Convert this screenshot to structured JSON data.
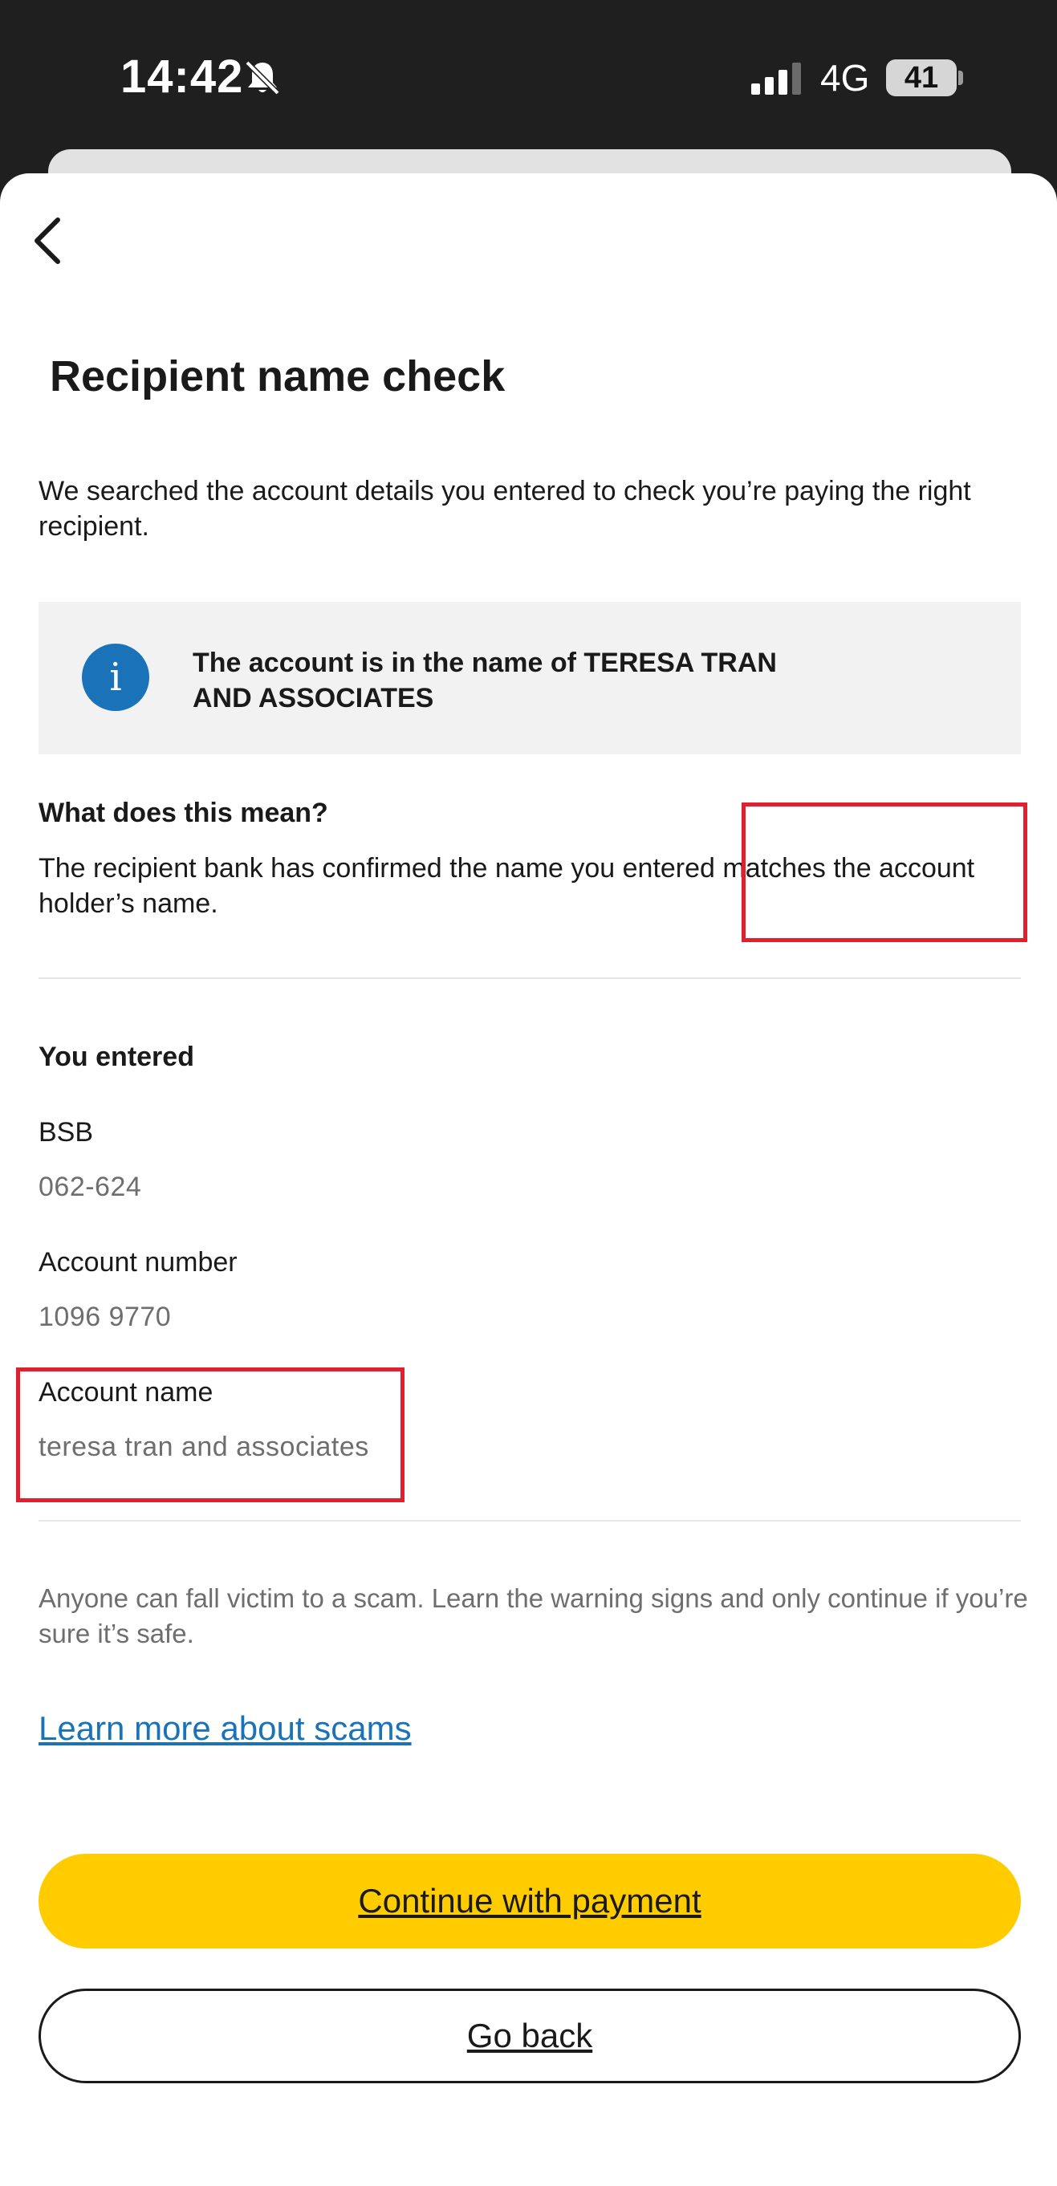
{
  "status_bar": {
    "time": "14:42",
    "network": "4G",
    "battery": "41"
  },
  "page": {
    "title": "Recipient name check",
    "intro": "We searched the account details you entered to check you’re paying the right recipient."
  },
  "info_box": {
    "icon": "info-icon",
    "line1": "The account is in the name of TERESA TRAN",
    "line2": "AND ASSOCIATES"
  },
  "explanation": {
    "heading": "What does this mean?",
    "body": "The recipient bank has confirmed the name you entered matches the account holder’s name."
  },
  "entered": {
    "heading": "You entered",
    "bsb_label": "BSB",
    "bsb_value": "062-624",
    "account_number_label": "Account number",
    "account_number_value": "1096 9770",
    "account_name_label": "Account name",
    "account_name_value": "teresa tran and associates"
  },
  "warning": {
    "text": "Anyone can fall victim to a scam. Learn the warning signs and only continue if you’re sure it’s safe.",
    "link": "Learn more about scams"
  },
  "actions": {
    "continue_label": "Continue with payment",
    "go_back_label": "Go back"
  },
  "colors": {
    "accent_yellow": "#ffcc00",
    "link_blue": "#1a73b8",
    "annotation_red": "#e0202e"
  }
}
